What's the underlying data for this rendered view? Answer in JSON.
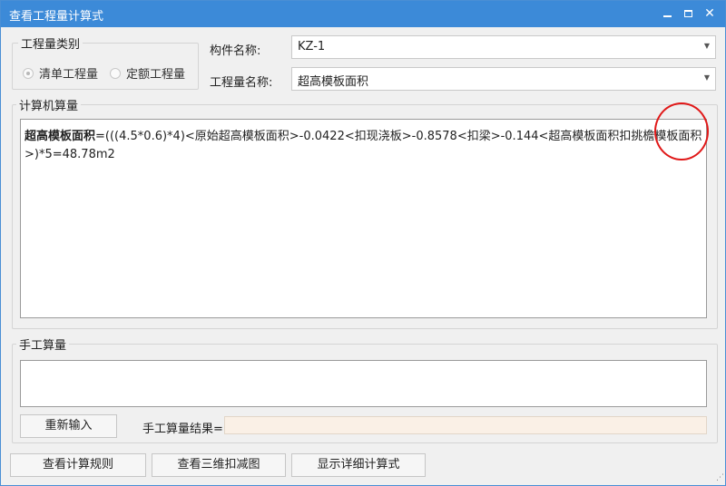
{
  "window": {
    "title": "查看工程量计算式",
    "min_label": "",
    "max_label": "",
    "close_label": "✕"
  },
  "quantity_type": {
    "legend": "工程量类别",
    "options": [
      {
        "label": "清单工程量",
        "selected": true
      },
      {
        "label": "定额工程量",
        "selected": false
      }
    ]
  },
  "component": {
    "label": "构件名称:",
    "value": "KZ-1"
  },
  "quantity_name": {
    "label": "工程量名称:",
    "value": "超高模板面积"
  },
  "computer": {
    "legend": "计算机算量",
    "formula_name": "超高模板面积",
    "formula_body": "=(((4.5*0.6)*4)<原始超高模板面积>-0.0422<扣现浇板>-0.8578<扣梁>-0.144<超高模板面积扣挑檐模板面积>)*5=48.78m2"
  },
  "manual": {
    "legend": "手工算量",
    "reenter_button": "重新输入",
    "result_label": "手工算量结果=",
    "result_value": ""
  },
  "footer": {
    "rules_button": "查看计算规则",
    "view3d_button": "查看三维扣减图",
    "detail_button": "显示详细计算式"
  },
  "colors": {
    "titlebar": "#3c8ad8",
    "annotation_circle": "#e01818",
    "result_field_bg": "#faf0e6"
  }
}
